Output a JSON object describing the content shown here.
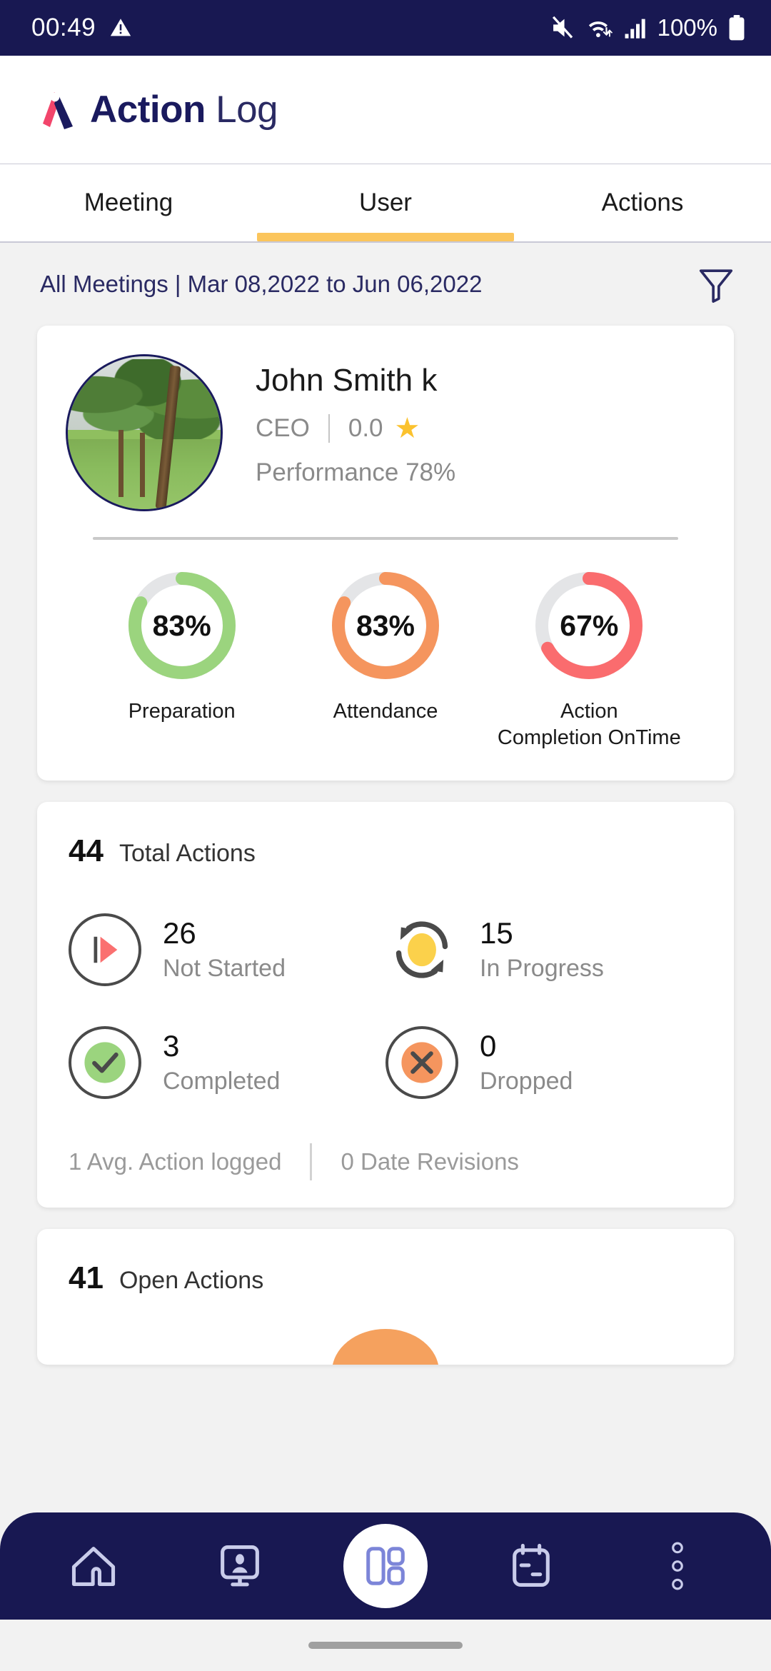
{
  "status_bar": {
    "time": "00:49",
    "battery_percent": "100%",
    "icons": [
      "warning-triangle-icon",
      "mute-icon",
      "wifi-icon",
      "signal-bars-icon",
      "battery-icon"
    ]
  },
  "app_header": {
    "title_bold": "Action",
    "title_light": "Log",
    "logo": "action-log-logo",
    "brand_pink": "#F2456B",
    "brand_navy": "#1A1A5E"
  },
  "tabs": {
    "items": [
      {
        "label": "Meeting",
        "active": false
      },
      {
        "label": "User",
        "active": true
      },
      {
        "label": "Actions",
        "active": false
      }
    ],
    "active_underline_color": "#FBC55C"
  },
  "filter_bar": {
    "text": "All Meetings | Mar 08,2022 to Jun 06,2022",
    "icon": "funnel-filter-icon"
  },
  "profile": {
    "name": "John Smith k",
    "role": "CEO",
    "rating": "0.0",
    "star_icon": "★",
    "performance": "Performance 78%",
    "avatar": "user-avatar-photo"
  },
  "chart_data": {
    "type": "pie",
    "title": "User performance gauges",
    "gauges": [
      {
        "label": "Preparation",
        "value": 83,
        "display": "83%",
        "color": "#9BD47E",
        "track": "#E4E5E7"
      },
      {
        "label": "Attendance",
        "value": 83,
        "display": "83%",
        "color": "#F5955E",
        "track": "#E4E5E7"
      },
      {
        "label": "Action\nCompletion OnTime",
        "value": 67,
        "display": "67%",
        "color": "#FA6C6E",
        "track": "#E4E5E7"
      }
    ],
    "ylim": [
      0,
      100
    ],
    "legend": "none",
    "grid": false
  },
  "gauge_labels": {
    "preparation": "Preparation",
    "attendance": "Attendance",
    "action_line1": "Action",
    "action_line2": "Completion OnTime"
  },
  "total_actions": {
    "count": "44",
    "label": "Total Actions",
    "stats": [
      {
        "num": "26",
        "label": "Not Started",
        "icon": "play-icon",
        "color": "#FA7070"
      },
      {
        "num": "15",
        "label": "In Progress",
        "icon": "refresh-icon",
        "color": "#FBD14B"
      },
      {
        "num": "3",
        "label": "Completed",
        "icon": "check-icon",
        "color": "#9BD47E"
      },
      {
        "num": "0",
        "label": "Dropped",
        "icon": "close-icon",
        "color": "#F5955E"
      }
    ],
    "footer_left": "1 Avg. Action logged",
    "footer_right": "0 Date Revisions"
  },
  "open_actions": {
    "count": "41",
    "label": "Open Actions"
  },
  "bottom_nav": {
    "items": [
      {
        "name": "home",
        "icon": "home-icon",
        "active": false
      },
      {
        "name": "monitor",
        "icon": "user-monitor-icon",
        "active": false
      },
      {
        "name": "dashboard",
        "icon": "dashboard-icon",
        "active": true
      },
      {
        "name": "calendar",
        "icon": "calendar-icon",
        "active": false
      },
      {
        "name": "more",
        "icon": "more-vertical-icon",
        "active": false
      }
    ],
    "bar_color": "#181852",
    "active_bg": "#FFFFFF",
    "icon_color": "#C9CCEA"
  }
}
